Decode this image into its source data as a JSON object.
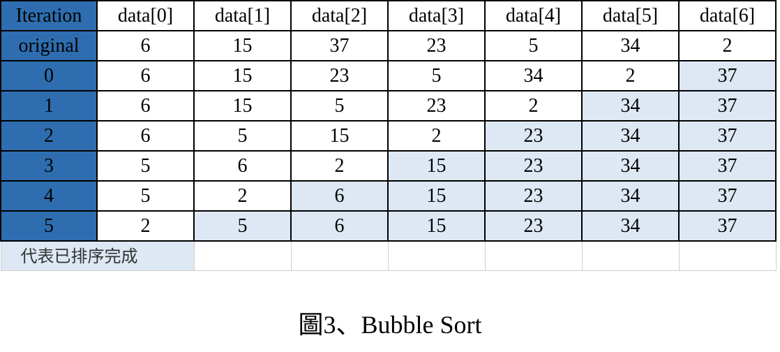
{
  "table": {
    "header": [
      "Iteration",
      "data[0]",
      "data[1]",
      "data[2]",
      "data[3]",
      "data[4]",
      "data[5]",
      "data[6]"
    ],
    "rows": [
      {
        "label": "original",
        "values": [
          "6",
          "15",
          "37",
          "23",
          "5",
          "34",
          "2"
        ],
        "sorted_from_index": 7
      },
      {
        "label": "0",
        "values": [
          "6",
          "15",
          "23",
          "5",
          "34",
          "2",
          "37"
        ],
        "sorted_from_index": 6
      },
      {
        "label": "1",
        "values": [
          "6",
          "15",
          "5",
          "23",
          "2",
          "34",
          "37"
        ],
        "sorted_from_index": 5
      },
      {
        "label": "2",
        "values": [
          "6",
          "5",
          "15",
          "2",
          "23",
          "34",
          "37"
        ],
        "sorted_from_index": 4
      },
      {
        "label": "3",
        "values": [
          "5",
          "6",
          "2",
          "15",
          "23",
          "34",
          "37"
        ],
        "sorted_from_index": 3
      },
      {
        "label": "4",
        "values": [
          "5",
          "2",
          "6",
          "15",
          "23",
          "34",
          "37"
        ],
        "sorted_from_index": 2
      },
      {
        "label": "5",
        "values": [
          "2",
          "5",
          "6",
          "15",
          "23",
          "34",
          "37"
        ],
        "sorted_from_index": 1
      }
    ],
    "legend_label": "代表已排序完成"
  },
  "caption": "圖3、Bubble Sort",
  "colors": {
    "header_blue": "#2e6eb0",
    "sorted_fill": "#dde8f4",
    "grid_line": "#000000"
  }
}
